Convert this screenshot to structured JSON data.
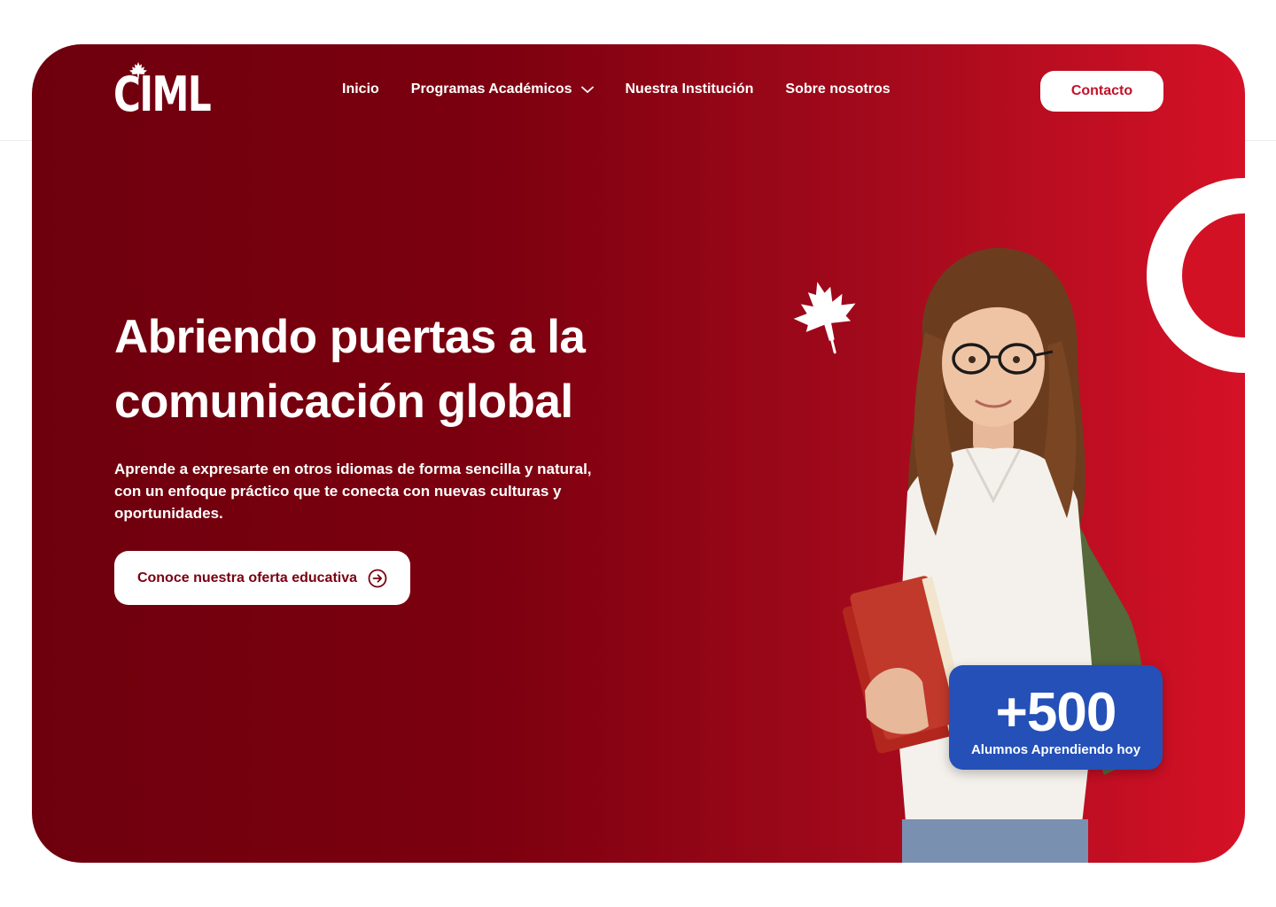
{
  "brand": {
    "logo_text": "CIML"
  },
  "nav": {
    "items": [
      {
        "label": "Inicio"
      },
      {
        "label": "Programas Académicos"
      },
      {
        "label": "Nuestra Institución"
      },
      {
        "label": "Sobre nosotros"
      }
    ],
    "contact_label": "Contacto"
  },
  "hero": {
    "headline_line1": "Abriendo puertas a la",
    "headline_line2": "comunicación global",
    "subtext": "Aprende a expresarte en otros idiomas de forma sencilla y natural, con un enfoque práctico que te conecta con nuevas culturas y oportunidades.",
    "cta_label": "Conoce nuestra oferta educativa"
  },
  "badge": {
    "count": "+500",
    "label": "Alumnos  Aprendiendo hoy"
  },
  "icons": {
    "dropdown": "chevron-down-icon",
    "cta": "arrow-circle-right-icon",
    "decoration": "maple-leaf-icon"
  },
  "colors": {
    "hero_dark": "#6e000d",
    "hero_light": "#d51126",
    "badge_blue": "#2450b7",
    "cta_text": "#7a0011",
    "contact_text": "#c3102a"
  }
}
